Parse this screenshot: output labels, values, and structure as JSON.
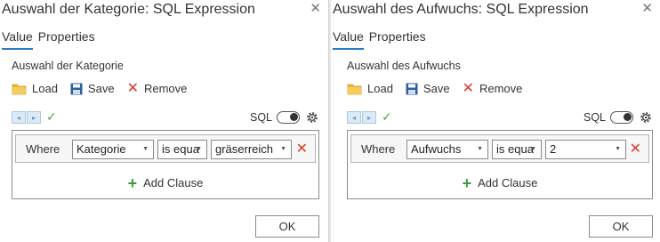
{
  "colors": {
    "accent": "#2a7bc1",
    "remove": "#d83b2a",
    "add": "#3d9a3d",
    "folder": "#e9b83a",
    "save": "#2f5f9e"
  },
  "dialogs": [
    {
      "title": "Auswahl der Kategorie: SQL Expression",
      "tabs": [
        {
          "label": "Value"
        },
        {
          "label": "Properties"
        }
      ],
      "section_label": "Auswahl der Kategorie",
      "actions": {
        "load": "Load",
        "save": "Save",
        "remove": "Remove"
      },
      "sql_label": "SQL",
      "clause": {
        "where": "Where",
        "field": "Kategorie",
        "operator": "is equa",
        "value": "gräserreich"
      },
      "add_clause": "Add Clause",
      "ok": "OK"
    },
    {
      "title": "Auswahl des Aufwuchs: SQL Expression",
      "tabs": [
        {
          "label": "Value"
        },
        {
          "label": "Properties"
        }
      ],
      "section_label": "Auswahl des Aufwuchs",
      "actions": {
        "load": "Load",
        "save": "Save",
        "remove": "Remove"
      },
      "sql_label": "SQL",
      "clause": {
        "where": "Where",
        "field": "Aufwuchs",
        "operator": "is equa",
        "value": "2"
      },
      "add_clause": "Add Clause",
      "ok": "OK"
    }
  ]
}
